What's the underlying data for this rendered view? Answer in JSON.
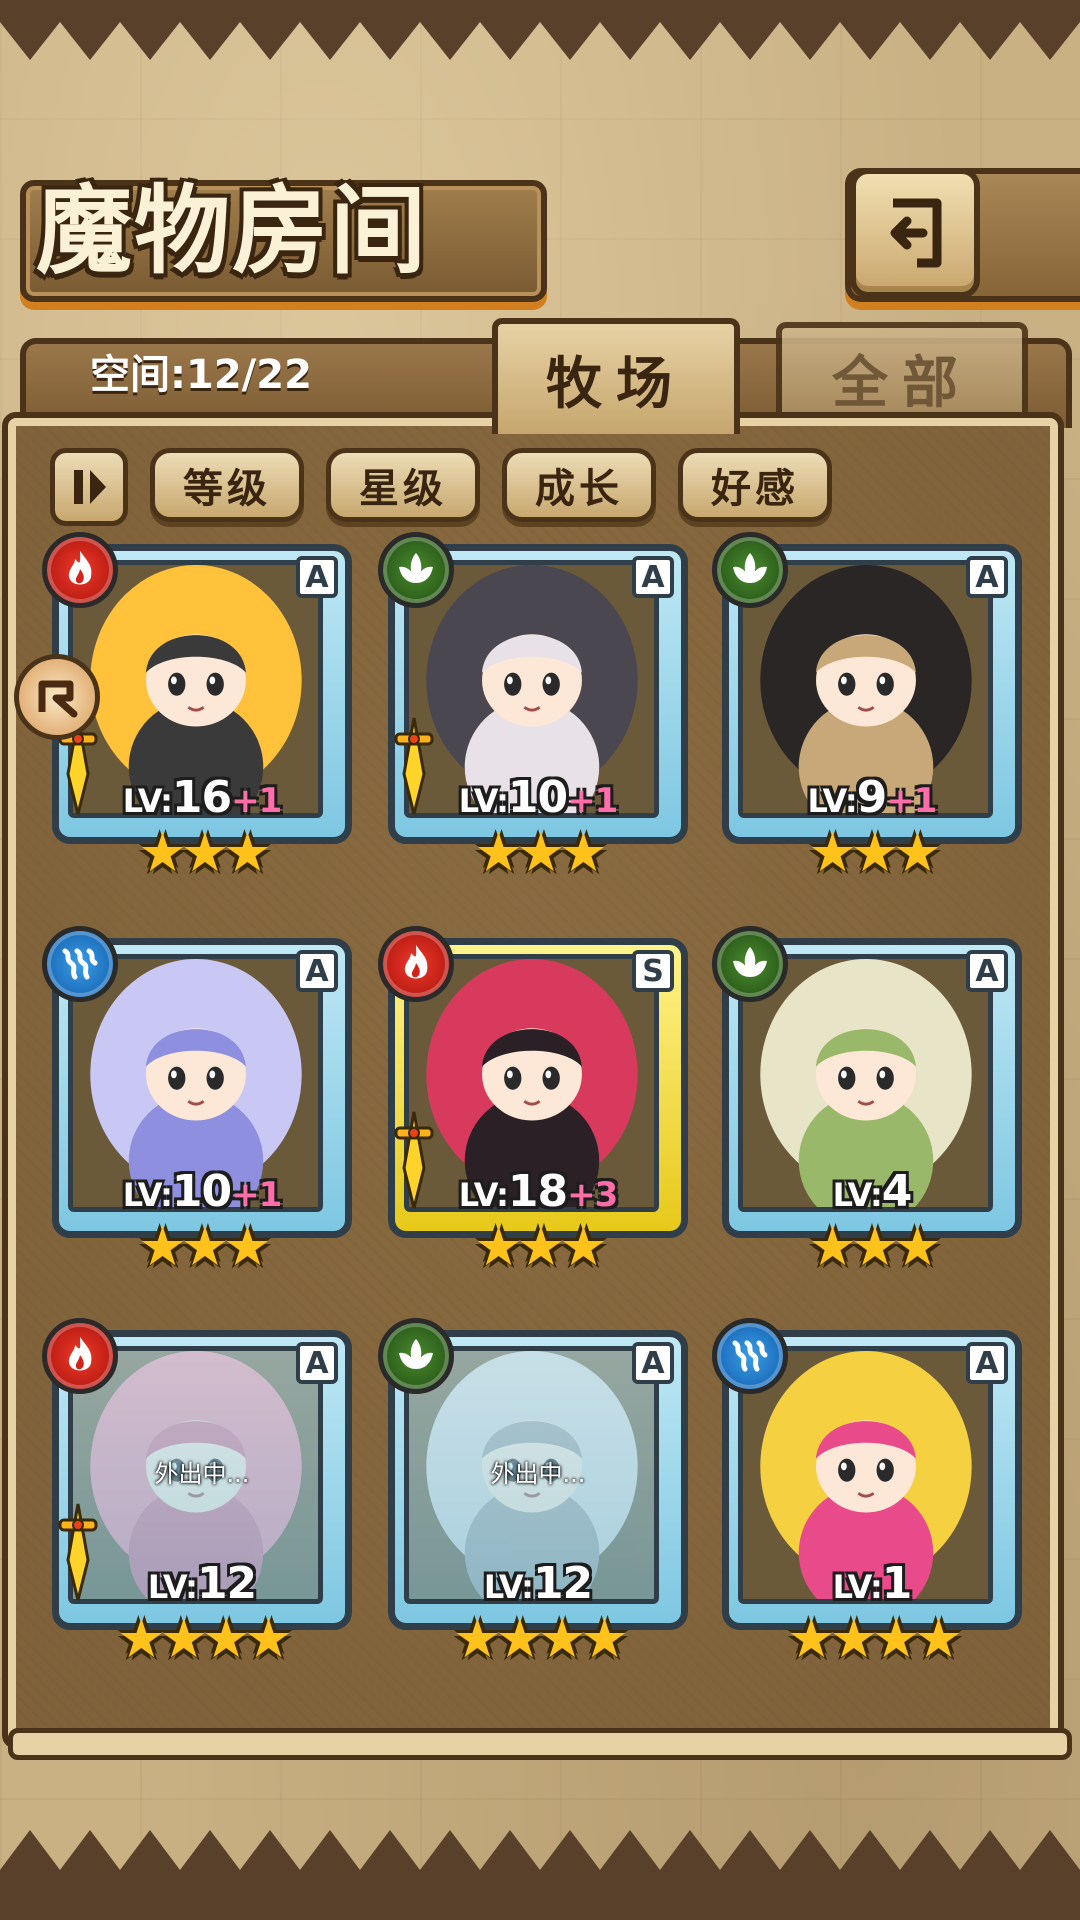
{
  "header": {
    "title": "魔物房间",
    "back_icon": "return-arrow-icon"
  },
  "tabs": {
    "space_label": "空间:12/22",
    "active": "牧场",
    "inactive": "全部"
  },
  "sort_bar": {
    "toggle_icon": "pause-sort-icon",
    "buttons": [
      "等级",
      "星级",
      "成长",
      "好感"
    ]
  },
  "colors": {
    "frame_a": "#7ec7e2",
    "frame_s": "#e7c919",
    "fire": "#d2241a",
    "grass": "#3a7a24",
    "water": "#1f7fd0",
    "bonus": "#ff6ea8",
    "star": "#ffc21a"
  },
  "monsters": [
    {
      "element": "fire",
      "rank": "A",
      "level": "16",
      "bonus": "+1",
      "stars": "★★★",
      "sword": true,
      "away": "",
      "palette": [
        "#ffc23a",
        "#3a3a3a"
      ]
    },
    {
      "element": "grass",
      "rank": "A",
      "level": "10",
      "bonus": "+1",
      "stars": "★★★",
      "sword": true,
      "away": "",
      "palette": [
        "#4a4750",
        "#e8e2e8"
      ]
    },
    {
      "element": "grass",
      "rank": "A",
      "level": "9",
      "bonus": "+1",
      "stars": "★★★",
      "sword": false,
      "away": "",
      "palette": [
        "#2a2626",
        "#c8a878"
      ]
    },
    {
      "element": "water",
      "rank": "A",
      "level": "10",
      "bonus": "+1",
      "stars": "★★★",
      "sword": false,
      "away": "",
      "palette": [
        "#c9c8f5",
        "#8f8fe0"
      ]
    },
    {
      "element": "fire",
      "rank": "S",
      "level": "18",
      "bonus": "+3",
      "stars": "★★★",
      "sword": true,
      "away": "",
      "palette": [
        "#d83a5e",
        "#2a2026"
      ]
    },
    {
      "element": "grass",
      "rank": "A",
      "level": "4",
      "bonus": "",
      "stars": "★★★",
      "sword": false,
      "away": "",
      "palette": [
        "#e8e4c8",
        "#9ab86a"
      ]
    },
    {
      "element": "fire",
      "rank": "A",
      "level": "12",
      "bonus": "",
      "stars": "★★★★",
      "sword": true,
      "away": "外出中...",
      "palette": [
        "#f08aa0",
        "#d86a88"
      ]
    },
    {
      "element": "grass",
      "rank": "A",
      "level": "12",
      "bonus": "",
      "stars": "★★★★",
      "sword": false,
      "away": "外出中...",
      "palette": [
        "#d8d8d8",
        "#a0a0a0"
      ]
    },
    {
      "element": "water",
      "rank": "A",
      "level": "1",
      "bonus": "",
      "stars": "★★★★",
      "sword": false,
      "away": "",
      "palette": [
        "#f5d040",
        "#e84a8a"
      ]
    }
  ],
  "side_badge_icon": "arrow-badge-icon"
}
